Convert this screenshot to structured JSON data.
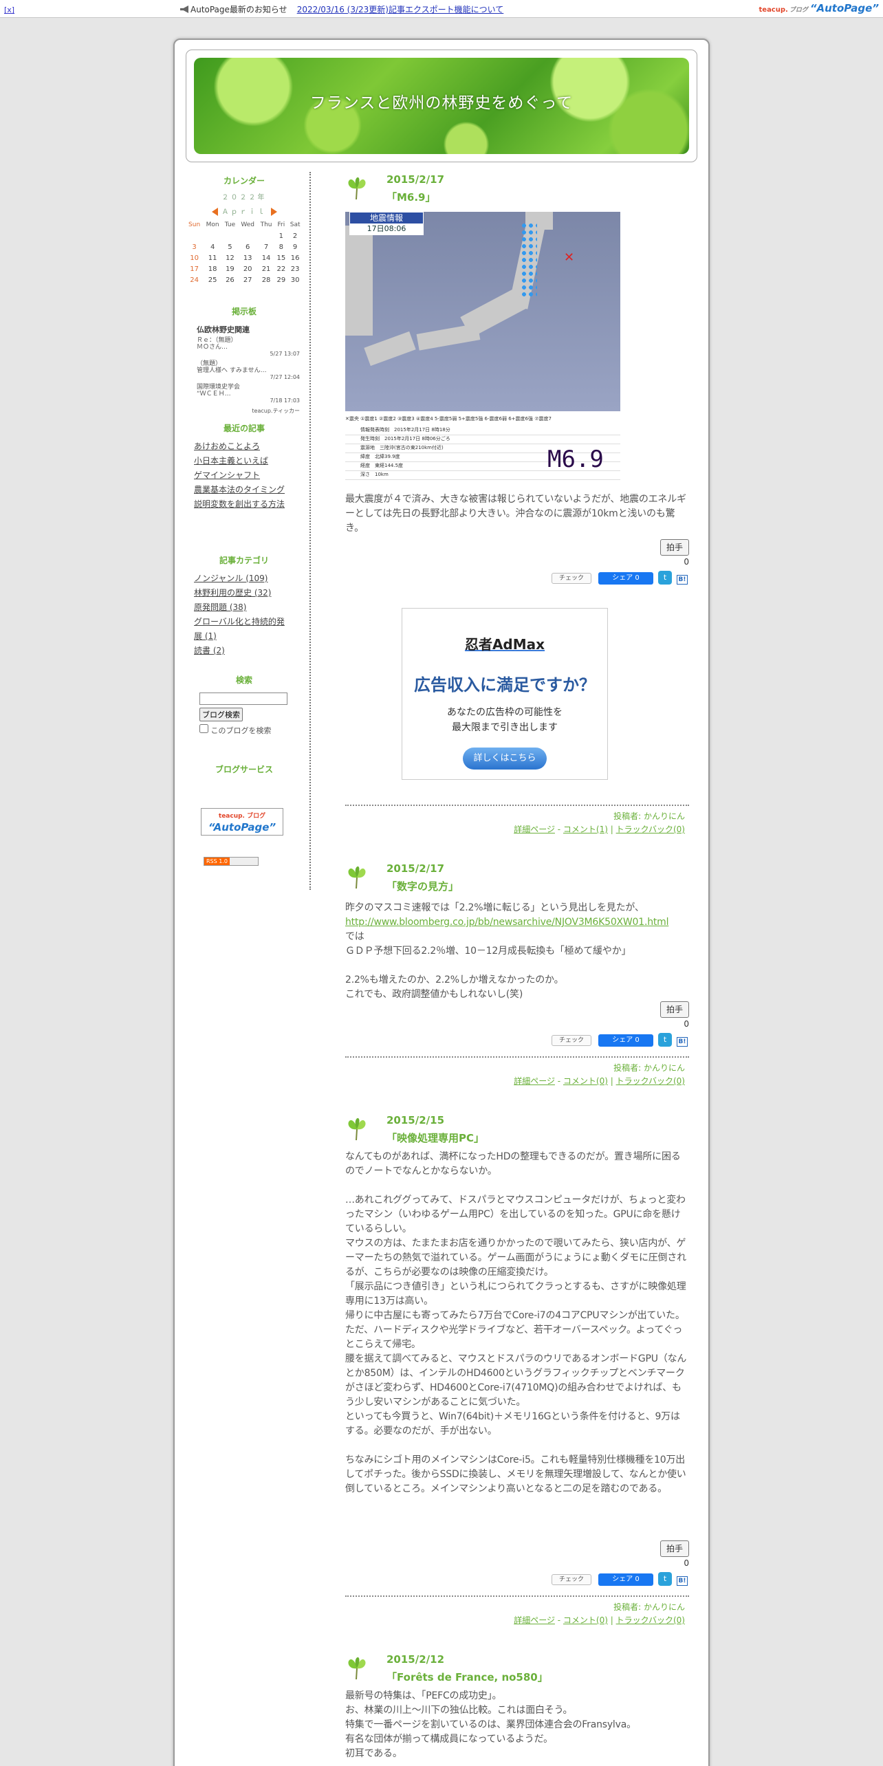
{
  "topbar": {
    "close": "[x]",
    "notice_label": "AutoPage最新のお知らせ",
    "notice_link": "2022/03/16 (3/23更新)記事エクスポート機能について",
    "logo_small": "teacup.",
    "logo_blog": "ブログ",
    "logo_main": "“AutoPage”"
  },
  "blog": {
    "title": "フランスと欧州の林野史をめぐって"
  },
  "sidebar": {
    "calendar": {
      "title": "カレンダー",
      "year": "２０２２年",
      "month": "Ａｐｒｉｌ",
      "days_header": [
        "Sun",
        "Mon",
        "Tue",
        "Wed",
        "Thu",
        "Fri",
        "Sat"
      ],
      "weeks": [
        [
          "",
          "",
          "",
          "",
          "",
          "1",
          "2"
        ],
        [
          "3",
          "4",
          "5",
          "6",
          "7",
          "8",
          "9"
        ],
        [
          "10",
          "11",
          "12",
          "13",
          "14",
          "15",
          "16"
        ],
        [
          "17",
          "18",
          "19",
          "20",
          "21",
          "22",
          "23"
        ],
        [
          "24",
          "25",
          "26",
          "27",
          "28",
          "29",
          "30"
        ]
      ]
    },
    "bbs": {
      "title": "掲示板",
      "board": "仏欧林野史関連",
      "items": [
        {
          "text": "Ｒｅ：（無題）\nＭＯさん…",
          "date": "5/27 13:07"
        },
        {
          "text": "（無題）\n管理人様へ すみません…",
          "date": "7/27 12:04"
        },
        {
          "text": "国際環境史学会\n“ＷＣＥＨ…",
          "date": "7/18 17:03"
        }
      ],
      "ticker": "teacup.ティッカー"
    },
    "recent": {
      "title": "最近の記事",
      "items": [
        "あけおめことよろ",
        "小日本主義といえば",
        "ゲマインシャフト",
        "農業基本法のタイミング",
        "説明変数を創出する方法"
      ]
    },
    "categories": {
      "title": "記事カテゴリ",
      "items": [
        "ノンジャンル (109)",
        "林野利用の歴史 (32)",
        "原発問題 (38)",
        "グローバル化と持続的発展 (1)",
        "読書 (2)"
      ]
    },
    "search": {
      "title": "検索",
      "button": "ブログ検索",
      "checkbox_label": "このブログを検索"
    },
    "services": {
      "title": "ブログサービス",
      "logo_small": "teacup. ブログ",
      "logo_main": "“AutoPage”",
      "rss": "RSS 1.0"
    }
  },
  "common": {
    "clap": "拍手",
    "clap_count": "0",
    "check": "チェック",
    "fb_share": "シェア 0",
    "author": "投稿者: かんりにん",
    "detail": "詳細ページ"
  },
  "posts": [
    {
      "date": "2015/2/17",
      "title": "「M6.9」",
      "paragraphs": [
        "最大震度が４で済み、大きな被害は報じられていないようだが、地震のエネルギーとしては先日の長野北部より大きい。沖合なのに震源が10kmと浅いのも驚き。"
      ],
      "comments": "コメント(1)",
      "trackback": "トラックバック(0)",
      "quake": {
        "header": "地震情報",
        "time": "17日08:06",
        "magnitude": "M6.9",
        "legend": "✕震央 ①震度1 ②震度2 ③震度3 ④震度4 5-震度5弱 5+震度5強 6-震度6弱 6+震度6強 ⑦震度7",
        "rows": [
          "情報発表時刻　2015年2月17日 8時18分",
          "発生時刻　2015年2月17日 8時06分ごろ",
          "震源地　三陸沖(宮古の東210km付近)",
          "緯度　北緯39.9度",
          "経度　東経144.5度",
          "深さ　10km"
        ]
      }
    },
    {
      "date": "2015/2/17",
      "title": "「数字の見方」",
      "paragraphs": [
        "昨夕のマスコミ速報では「2.2%増に転じる」という見出しを見たが、",
        "http://www.bloomberg.co.jp/bb/newsarchive/NJOV3M6K50XW01.html",
        "では",
        "ＧＤＰ予想下回る2.2％増、10－12月成長転換も「極めて緩やか」",
        "",
        "2.2%も増えたのか、2.2%しか増えなかったのか。",
        "これでも、政府調整値かもしれないし(笑)"
      ],
      "comments": "コメント(0)",
      "trackback": "トラックバック(0)"
    },
    {
      "date": "2015/2/15",
      "title": "「映像処理専用PC」",
      "paragraphs": [
        "なんてものがあれば、満杯になったHDの整理もできるのだが。置き場所に困るのでノートでなんとかならないか。",
        "",
        "…あれこれググってみて、ドスパラとマウスコンピュータだけが、ちょっと変わったマシン（いわゆるゲーム用PC）を出しているのを知った。GPUに命を懸けているらしい。",
        "マウスの方は、たまたまお店を通りかかったので覗いてみたら、狭い店内が、ゲーマーたちの熱気で溢れている。ゲーム画面がうにょうにょ動くダモに圧倒されるが、こちらが必要なのは映像の圧縮変換だけ。",
        "「展示品につき値引き」という札につられてクラっとするも、さすがに映像処理専用に13万は高い。",
        "帰りに中古屋にも寄ってみたら7万台でCore-i7の4コアCPUマシンが出ていた。ただ、ハードディスクや光学ドライブなど、若干オーバースペック。よってぐっとこらえて帰宅。",
        "腰を据えて調べてみると、マウスとドスパラのウリであるオンボードGPU（なんとか850M）は、インテルのHD4600というグラフィックチップとベンチマークがさほど変わらず、HD4600とCore-i7(4710MQ)の組み合わせでよければ、もう少し安いマシンがあることに気づいた。",
        "といっても今買うと、Win7(64bit)＋メモリ16Gという条件を付けると、9万はする。必要なのだが、手が出ない。",
        "",
        "ちなみにシゴト用のメインマシンはCore-i5。これも軽量特別仕様機種を10万出してポチった。後からSSDに換装し、メモリを無理矢理増設して、なんとか使い倒しているところ。メインマシンより高いとなると二の足を踏むのである。"
      ],
      "comments": "コメント(0)",
      "trackback": "トラックバック(0)"
    },
    {
      "date": "2015/2/12",
      "title": "「Forêts de France, no580」",
      "paragraphs": [
        "最新号の特集は、「PEFCの成功史」。",
        "お、林業の川上～川下の独仏比較。これは面白そう。",
        "特集で一番ページを割いているのは、業界団体連合会のFransylva。",
        "有名な団体が揃って構成員になっているようだ。",
        "初耳である。"
      ]
    }
  ],
  "ad": {
    "brand": "忍者AdMax",
    "headline": "広告収入に満足ですか？",
    "sub1": "あなたの広告枠の可能性を",
    "sub2": "最大限まで引き出します",
    "button": "詳しくはこちら"
  }
}
